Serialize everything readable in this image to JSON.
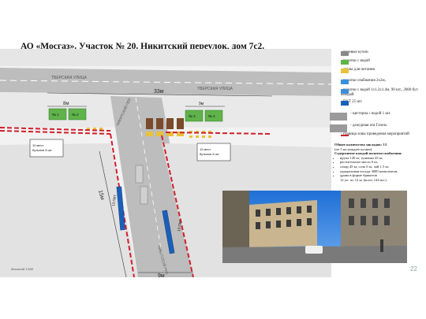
{
  "title": "АО «Мосгаз». Участок № 20. Никитский переулок, дом 7с2.",
  "streets": {
    "tverskaya_1": "ТВЕРСКАЯ УЛИЦА",
    "tverskaya_2": "ТВЕРСКАЯ УЛИЦА",
    "nikitsky_1": "НИКИТСКИЙ ПЕР.",
    "nikitsky_2": "НИКИТСКИЙ ПЕР."
  },
  "dimensions": {
    "d33": "33м",
    "d8": "8м",
    "d9": "9м",
    "d15": "15м",
    "d9b": "9м"
  },
  "boxes": {
    "b1": "№ 1",
    "b2": "№ 2",
    "b3": "№ 3",
    "b4": "№ 4"
  },
  "toilets_left": "10 мест\nбутылки 8 шт",
  "toilets_right": "12 мест\nбутылки 8 шт",
  "vertical_labels": {
    "left": "13 ПКТ",
    "right": "13 ПКТ"
  },
  "legend": [
    {
      "label": "- полевые кухни",
      "color": "#8a8a8a"
    },
    {
      "label": "- палатки с водой",
      "color": "#5fb34a"
    },
    {
      "label": "- столы для питания",
      "color": "#e8c23a"
    },
    {
      "label": "- палатки снабжения 2х2м,",
      "color": "#3a8fd8"
    },
    {
      "label": "- палатки с водой 1х1.2х1.4м, 90 шт., 2000 бут. каждый",
      "color": "#3a8fd8"
    },
    {
      "label": "- ПКТ 25 шт.",
      "color": "#1b5fb8"
    },
    {
      "label": "- цистерна с водой 1 шт.",
      "color": "#9a9a9a"
    },
    {
      "label": "- дежурная а/м Газель",
      "color": "#9a9a9a"
    },
    {
      "label": "- граница зоны проведения мероприятий",
      "color": "#d01f2c"
    }
  ],
  "summary": {
    "line1": "Общее количество закладок: 13",
    "line2": "(по 5 на каждую кухню).",
    "line3": "Содержимое каждой палатки снабжения:",
    "items": [
      "крупа 120 кг, тушенка 43 кг,",
      "растительное масло 6 кг,",
      "сахар 45 кг, соль 6 кг, чай 1.5 кг,",
      "одноразовая посуда 3000 комплектов,",
      "дрова в форме брикетов",
      "12 уп. по 12 кг (всего 144 шт.)."
    ]
  },
  "scale_text": "Масштаб 1:500",
  "page_number": "22",
  "colors": {
    "road": "#b9b9b9",
    "map_bg": "#ececec",
    "boundary": "#d01f2c",
    "green": "#5fb34a",
    "yellow": "#e8c23a",
    "blue": "#1b5fb8"
  }
}
